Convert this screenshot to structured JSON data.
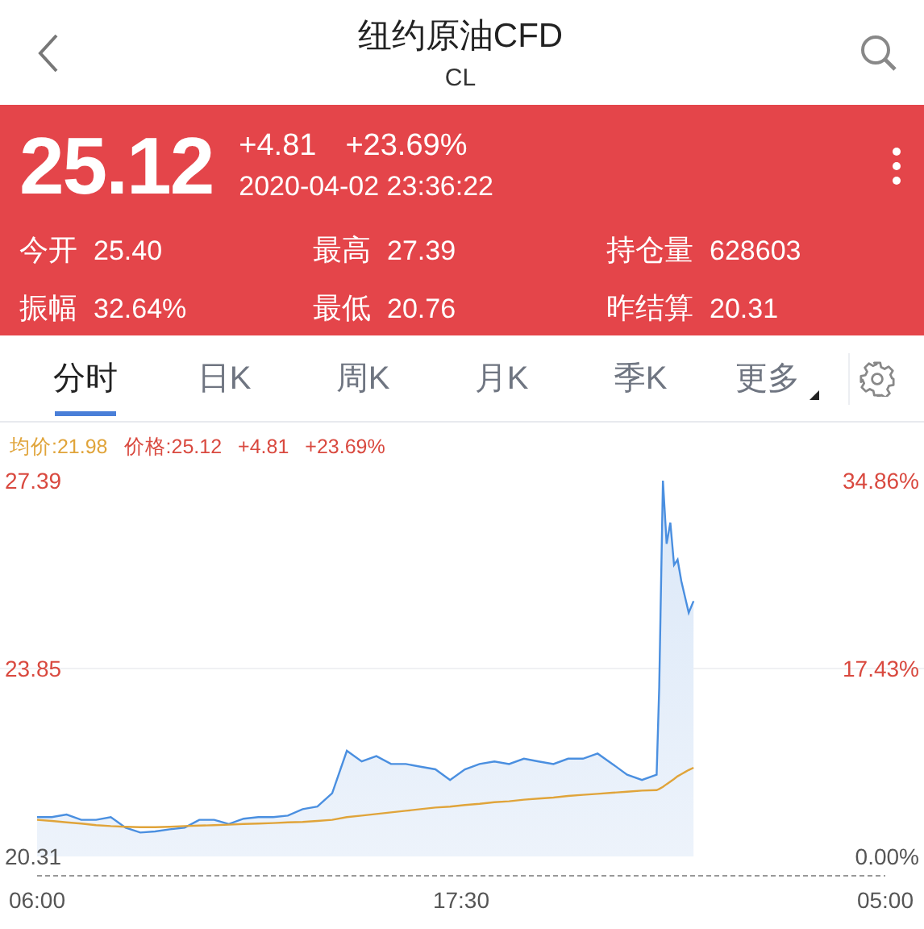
{
  "header": {
    "title": "纽约原油CFD",
    "subtitle": "CL"
  },
  "quote": {
    "price": "25.12",
    "change": "+4.81",
    "change_percent": "+23.69%",
    "datetime": "2020-04-02 23:36:22",
    "stats": [
      {
        "label": "今开",
        "value": "25.40"
      },
      {
        "label": "最高",
        "value": "27.39"
      },
      {
        "label": "持仓量",
        "value": "628603"
      },
      {
        "label": "振幅",
        "value": "32.64%"
      },
      {
        "label": "最低",
        "value": "20.76"
      },
      {
        "label": "昨结算",
        "value": "20.31"
      }
    ]
  },
  "tabs": [
    {
      "label": "分时",
      "selected": true,
      "dropdown": false
    },
    {
      "label": "日K",
      "selected": false,
      "dropdown": false
    },
    {
      "label": "周K",
      "selected": false,
      "dropdown": false
    },
    {
      "label": "月K",
      "selected": false,
      "dropdown": false
    },
    {
      "label": "季K",
      "selected": false,
      "dropdown": false
    },
    {
      "label": "更多",
      "selected": false,
      "dropdown": true
    }
  ],
  "chart": {
    "legend": [
      {
        "value": ":21.98",
        "color": "#e0a43a"
      },
      {
        "value": ":25.12",
        "color": "#d9493f"
      }
    ],
    "legend_extras": [
      {
        "text": "+4.81",
        "color": "#d9493f"
      },
      {
        "text": "+23.69%",
        "color": "#d9493f"
      }
    ],
    "right_axis_labels": [
      "34.86%",
      "17.43%",
      "0.00%"
    ],
    "next_day_end_label": "05:00",
    "chart_data": {
      "type": "line",
      "xlim": [
        6,
        29
      ],
      "ylim": [
        20.31,
        27.39
      ],
      "xticks": [
        {
          "value": 6,
          "label": "06:00"
        },
        {
          "value": 17.5,
          "label": "17:30"
        }
      ],
      "yticks": [
        {
          "value": 27.39,
          "label": "27.39"
        },
        {
          "value": 23.85,
          "label": "23.85"
        },
        {
          "value": 20.31,
          "label": "20.31"
        }
      ],
      "x": [
        6,
        6.4,
        6.8,
        7.2,
        7.6,
        8,
        8.4,
        8.8,
        9.2,
        9.6,
        10,
        10.4,
        10.8,
        11.2,
        11.6,
        12,
        12.4,
        12.8,
        13.2,
        13.6,
        14,
        14.4,
        14.8,
        15.2,
        15.6,
        16,
        16.4,
        16.8,
        17.2,
        17.6,
        18,
        18.4,
        18.8,
        19.2,
        19.6,
        20,
        20.4,
        20.8,
        21.2,
        21.6,
        22,
        22.4,
        22.8,
        22.87,
        22.97,
        23.07,
        23.17,
        23.27,
        23.37,
        23.47,
        23.57,
        23.67,
        23.8
      ],
      "series": [
        {
          "name": "均价",
          "color": "#e0a43a",
          "type": "line",
          "values": [
            21.0,
            20.98,
            20.95,
            20.93,
            20.9,
            20.88,
            20.87,
            20.86,
            20.86,
            20.87,
            20.88,
            20.89,
            20.9,
            20.91,
            20.92,
            20.93,
            20.94,
            20.95,
            20.96,
            20.98,
            21.0,
            21.05,
            21.08,
            21.11,
            21.14,
            21.17,
            21.2,
            21.23,
            21.25,
            21.28,
            21.3,
            21.33,
            21.35,
            21.38,
            21.4,
            21.42,
            21.45,
            21.47,
            21.49,
            21.51,
            21.53,
            21.55,
            21.56,
            21.58,
            21.62,
            21.67,
            21.72,
            21.77,
            21.82,
            21.86,
            21.9,
            21.94,
            21.98
          ]
        },
        {
          "name": "价格",
          "color": "#4a8fe0",
          "type": "area",
          "values": [
            21.05,
            21.05,
            21.1,
            21.0,
            21.0,
            21.05,
            20.85,
            20.76,
            20.78,
            20.82,
            20.85,
            21.0,
            21.0,
            20.92,
            21.02,
            21.05,
            21.05,
            21.08,
            21.2,
            21.25,
            21.5,
            22.3,
            22.1,
            22.2,
            22.05,
            22.05,
            22.0,
            21.95,
            21.75,
            21.95,
            22.05,
            22.1,
            22.05,
            22.15,
            22.1,
            22.05,
            22.15,
            22.15,
            22.25,
            22.05,
            21.85,
            21.75,
            21.85,
            23.5,
            27.39,
            26.2,
            26.6,
            25.8,
            25.9,
            25.5,
            25.2,
            24.9,
            25.12
          ]
        }
      ]
    }
  }
}
